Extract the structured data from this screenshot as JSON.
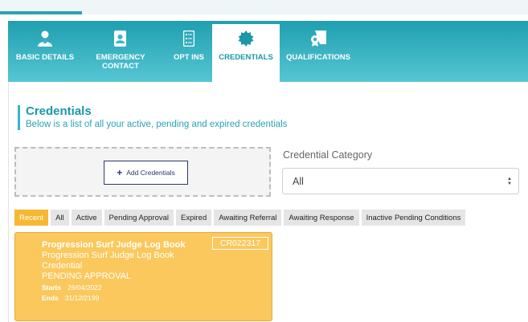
{
  "tabs": [
    {
      "label": "BASIC DETAILS",
      "icon": "person-icon"
    },
    {
      "label": "EMERGENCY CONTACT",
      "icon": "contact-card-icon"
    },
    {
      "label": "OPT INS",
      "icon": "checklist-icon"
    },
    {
      "label": "CREDENTIALS",
      "icon": "badge-icon"
    },
    {
      "label": "QUALIFICATIONS",
      "icon": "certificate-icon"
    }
  ],
  "active_tab": "CREDENTIALS",
  "section": {
    "title": "Credentials",
    "subtitle": "Below is a list of all your active, pending and expired credentials"
  },
  "add_button": {
    "label": "Add Credentials"
  },
  "category": {
    "label": "Credential Category",
    "selected": "All"
  },
  "filters": [
    {
      "label": "Recent",
      "active": true
    },
    {
      "label": "All"
    },
    {
      "label": "Active"
    },
    {
      "label": "Pending Approval"
    },
    {
      "label": "Expired"
    },
    {
      "label": "Awaiting Referral"
    },
    {
      "label": "Awaiting Response"
    },
    {
      "label": "Inactive Pending Conditions"
    }
  ],
  "card": {
    "title": "Progression Surf Judge Log Book",
    "name": "Progression Surf Judge Log Book",
    "type": "Credential",
    "status": "PENDING APPROVAL",
    "code": "CR022317",
    "starts_label": "Starts",
    "starts": "26/04/2022",
    "ends_label": "Ends",
    "ends": "31/12/2199"
  },
  "colors": {
    "tab_gradient_top": "#1f9fb0",
    "tab_gradient_bottom": "#56c6d3",
    "accent": "#1a98aa",
    "filter_active": "#f5b833",
    "card_bg": "#fac85c"
  }
}
